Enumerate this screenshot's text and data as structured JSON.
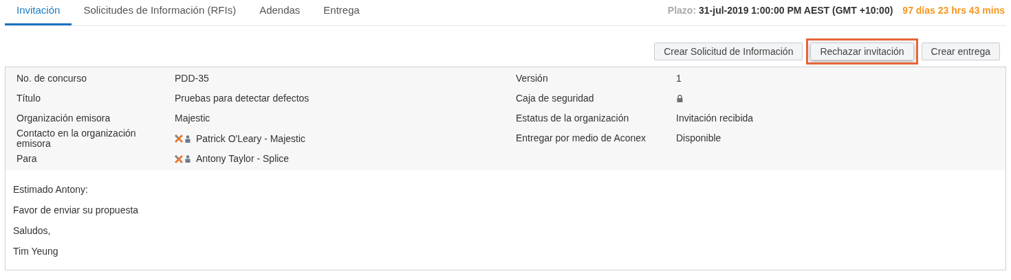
{
  "tabs": [
    {
      "label": "Invitación",
      "selected": true
    },
    {
      "label": "Solicitudes de Información (RFIs)",
      "selected": false
    },
    {
      "label": "Adendas",
      "selected": false
    },
    {
      "label": "Entrega",
      "selected": false
    }
  ],
  "deadline": {
    "label": "Plazo:",
    "date": "31-jul-2019 1:00:00 PM AEST (GMT +10:00)",
    "remaining": "97 días 23 hrs 43 mins"
  },
  "actions": [
    {
      "label": "Crear Solicitud de Información",
      "highlighted": false
    },
    {
      "label": "Rechazar invitación",
      "highlighted": true
    },
    {
      "label": "Crear entrega",
      "highlighted": false
    }
  ],
  "details_left": [
    {
      "label": "No. de concurso",
      "kind": "text",
      "value": "PDD-35"
    },
    {
      "label": "Título",
      "kind": "text",
      "value": "Pruebas para detectar defectos"
    },
    {
      "label": "Organización emisora",
      "kind": "text",
      "value": "Majestic"
    },
    {
      "label": "Contacto en la organización emisora",
      "kind": "contact",
      "value": "Patrick O'Leary - Majestic"
    },
    {
      "label": "Para",
      "kind": "contact",
      "value": "Antony Taylor - Splice"
    }
  ],
  "details_right": [
    {
      "label": "Versión",
      "kind": "text",
      "value": "1"
    },
    {
      "label": "Caja de seguridad",
      "kind": "lock"
    },
    {
      "label": "Estatus de la organización",
      "kind": "text",
      "value": "Invitación recibida"
    },
    {
      "label": "Entregar por medio de Aconex",
      "kind": "text",
      "value": "Disponible"
    }
  ],
  "message": [
    "Estimado Antony:",
    "Favor de enviar su propuesta",
    "Saludos,",
    "Tim Yeung"
  ]
}
